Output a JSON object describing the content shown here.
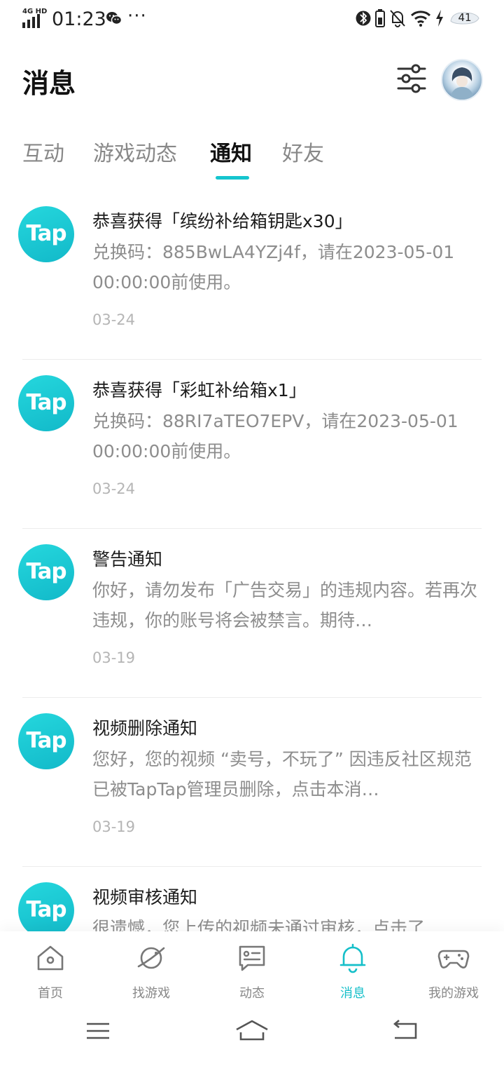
{
  "status_bar": {
    "network": "4G HD",
    "time": "01:23",
    "battery": "41"
  },
  "header": {
    "title": "消息"
  },
  "tabs": [
    {
      "label": "互动"
    },
    {
      "label": "游戏动态"
    },
    {
      "label": "通知"
    },
    {
      "label": "好友"
    }
  ],
  "notifications": [
    {
      "logo_text": "Tap",
      "title": "恭喜获得「缤纷补给箱钥匙x30」",
      "body": "兑换码：885BwLA4YZj4f，请在2023-05-01 00:00:00前使用。",
      "date": "03-24"
    },
    {
      "logo_text": "Tap",
      "title": "恭喜获得「彩虹补给箱x1」",
      "body": "兑换码：88RI7aTEO7EPV，请在2023-05-01 00:00:00前使用。",
      "date": "03-24"
    },
    {
      "logo_text": "Tap",
      "title": "警告通知",
      "body": "你好，请勿发布「广告交易」的违规内容。若再次违规，你的账号将会被禁言。期待…",
      "date": "03-19"
    },
    {
      "logo_text": "Tap",
      "title": "视频删除通知",
      "body": "您好，您的视频 “卖号，不玩了” 因违反社区规范已被TapTap管理员删除，点击本消…",
      "date": "03-19"
    },
    {
      "logo_text": "Tap",
      "title": "视频审核通知",
      "body": "很遗憾，您上传的视频未通过审核，点击了",
      "date": ""
    }
  ],
  "bottom_nav": [
    {
      "label": "首页",
      "icon": "home-icon"
    },
    {
      "label": "找游戏",
      "icon": "planet-icon"
    },
    {
      "label": "动态",
      "icon": "chat-card-icon"
    },
    {
      "label": "消息",
      "icon": "bell-icon"
    },
    {
      "label": "我的游戏",
      "icon": "gamepad-icon"
    }
  ],
  "colors": {
    "accent": "#15c5ce",
    "text_primary": "#1c1c1c",
    "text_secondary": "#8d8d8d",
    "text_muted": "#b5b5b5"
  }
}
